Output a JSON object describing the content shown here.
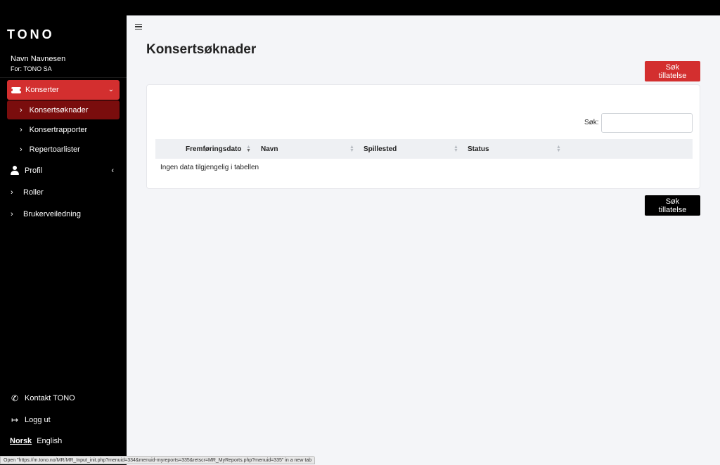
{
  "sidebar": {
    "logo": "TONO",
    "user": {
      "name": "Navn Navnesen",
      "org": "For: TONO SA"
    },
    "konserter": {
      "label": "Konserter",
      "children": [
        {
          "label": "Konsertsøknader",
          "active": true
        },
        {
          "label": "Konsertrapporter",
          "active": false
        },
        {
          "label": "Repertoarlister",
          "active": false
        }
      ]
    },
    "items": [
      {
        "label": "Profil"
      },
      {
        "label": "Roller"
      },
      {
        "label": "Brukerveiledning"
      }
    ],
    "bottom": {
      "contact": "Kontakt TONO",
      "logout": "Logg ut",
      "lang_norsk": "Norsk",
      "lang_english": "English"
    }
  },
  "main": {
    "title": "Konsertsøknader",
    "button_top": "Søk tillatelse",
    "button_bottom": "Søk tillatelse",
    "search_label": "Søk:",
    "search_value": "",
    "table": {
      "columns": [
        "Fremføringsdato",
        "Navn",
        "Spillested",
        "Status"
      ],
      "empty_text": "Ingen data tilgjengelig i tabellen"
    }
  },
  "statusbar": {
    "text": "Open \"https://m.tono.no/MR/MR_Input_init.php?menuid=334&menuid-myreports=335&retscr=MR_MyReports.php?menuid=335\" in a new tab"
  },
  "colors": {
    "accent": "#d32f2f",
    "active_sub": "#7a0d0d",
    "sidebar_bg": "#000000",
    "main_bg": "#f4f5f8"
  }
}
